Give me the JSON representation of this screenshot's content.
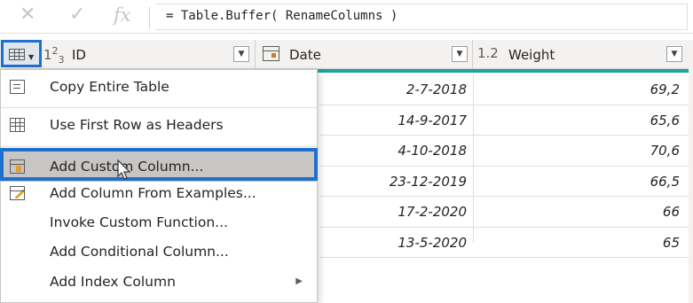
{
  "formula_bar": {
    "cancel_icon": "✕",
    "confirm_icon": "✓",
    "fx_label": "fx",
    "formula": "= Table.Buffer( RenameColumns )"
  },
  "columns": [
    {
      "type_icon": "1²3",
      "name": "ID"
    },
    {
      "type_icon": "calendar",
      "name": "Date"
    },
    {
      "type_icon": "1.2",
      "name": "Weight"
    }
  ],
  "rows": [
    {
      "date": "2-7-2018",
      "weight": "69,2"
    },
    {
      "date": "14-9-2017",
      "weight": "65,6"
    },
    {
      "date": "4-10-2018",
      "weight": "70,6"
    },
    {
      "date": "23-12-2019",
      "weight": "66,5"
    },
    {
      "date": "17-2-2020",
      "weight": "66"
    },
    {
      "date": "13-5-2020",
      "weight": "65"
    }
  ],
  "menu": {
    "items": [
      {
        "label": "Copy Entire Table",
        "icon": "copy-icon"
      },
      {
        "label": "Use First Row as Headers",
        "icon": "table-grid-icon"
      },
      {
        "label": "Add Custom Column...",
        "icon": "custom-column-icon",
        "highlighted": true
      },
      {
        "label": "Add Column From Examples...",
        "icon": "column-from-examples-icon"
      },
      {
        "label": "Invoke Custom Function...",
        "icon": ""
      },
      {
        "label": "Add Conditional Column...",
        "icon": ""
      },
      {
        "label": "Add Index Column",
        "icon": "",
        "submenu": true
      }
    ]
  },
  "colors": {
    "selection_border": "#1e6fd0",
    "quality_bar": "#19a4a0",
    "menu_highlight": "#c8c6c4"
  }
}
